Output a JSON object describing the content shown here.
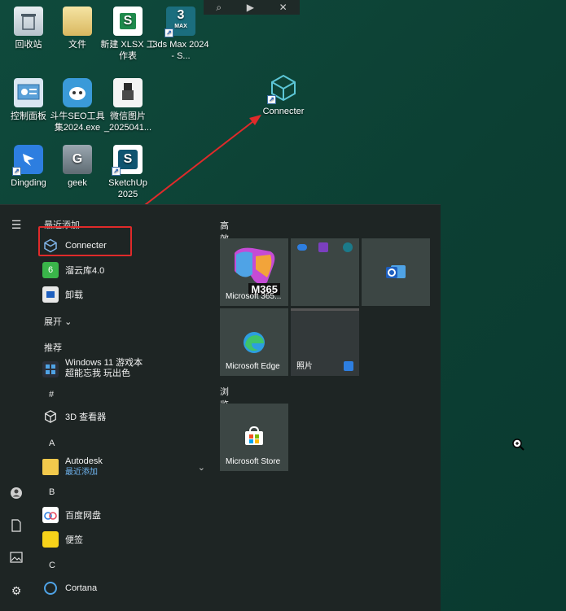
{
  "toolbar": {
    "search": "⌕",
    "play": "▶",
    "close": "✕"
  },
  "desktop": {
    "icons": [
      {
        "label": "回收站"
      },
      {
        "label": "文件"
      },
      {
        "label": "新建 XLSX 工作表"
      },
      {
        "label": "3ds Max 2024 - S..."
      },
      {
        "label": "控制面板"
      },
      {
        "label": "斗牛SEO工具集2024.exe"
      },
      {
        "label": "微信图片_2025041..."
      },
      {
        "label": "Connecter"
      },
      {
        "label": "Dingding"
      },
      {
        "label": "geek"
      },
      {
        "label": "SketchUp 2025"
      }
    ],
    "glyphs": {
      "max": "3",
      "max_sub": "MAX",
      "xlsx": "S",
      "sketchup": "S",
      "geek": "G"
    }
  },
  "start_menu": {
    "recently_added": "最近添加",
    "recent_items": [
      {
        "label": "Connecter"
      },
      {
        "label": "溜云库4.0"
      },
      {
        "label": "卸载"
      }
    ],
    "expand": "展开",
    "recommended": "推荐",
    "recommended_item": {
      "line1": "Windows 11 游戏本",
      "line2": "超能忘我 玩出色"
    },
    "groups": [
      {
        "letter": "#",
        "items": [
          {
            "label": "3D 查看器"
          }
        ]
      },
      {
        "letter": "A",
        "items": [
          {
            "label": "Autodesk",
            "sub": "最近添加"
          }
        ]
      },
      {
        "letter": "B",
        "items": [
          {
            "label": "百度网盘"
          },
          {
            "label": "便签"
          }
        ]
      },
      {
        "letter": "C",
        "items": [
          {
            "label": "Cortana"
          }
        ]
      }
    ],
    "tiles": {
      "group1_label": "高效工作",
      "group2_label": "浏览",
      "m365": "Microsoft 365...",
      "m365_badge": "M365",
      "edge": "Microsoft Edge",
      "photos": "照片",
      "store": "Microsoft Store"
    }
  },
  "colors": {
    "highlight": "#e02a2a",
    "accent": "#2d7ee0"
  }
}
